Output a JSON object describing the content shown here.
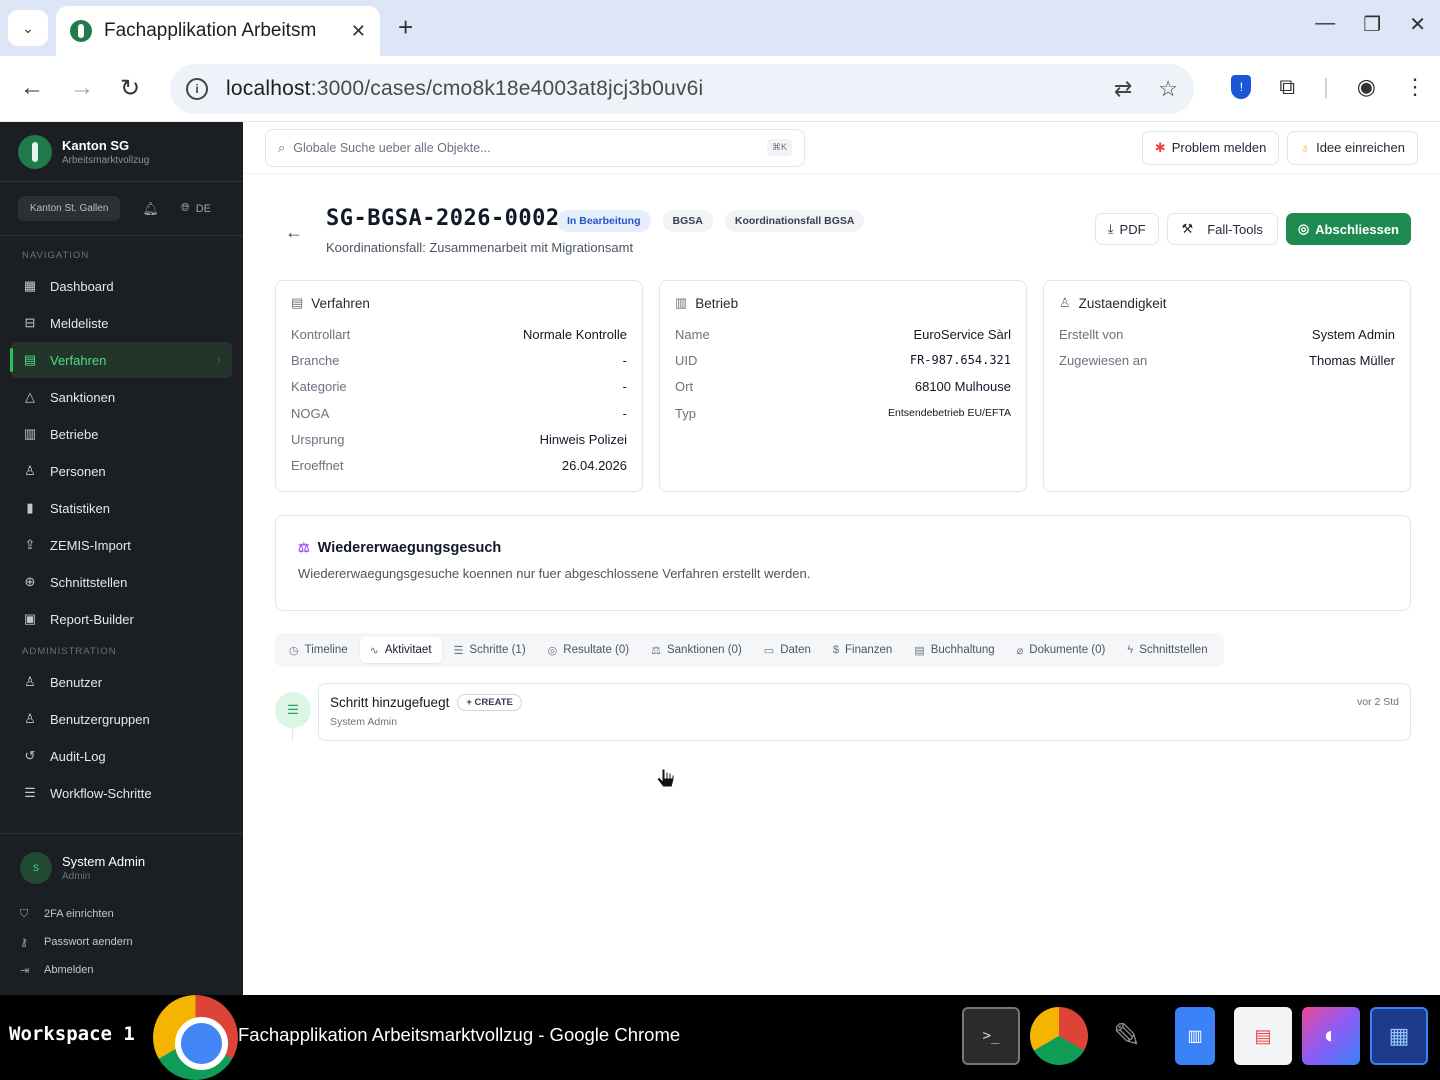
{
  "browser": {
    "tab_title": "Fachapplikation Arbeitsm",
    "url_host": "localhost",
    "url_path": ":3000/cases/cmo8k18e4003at8jcj3b0uv6i"
  },
  "sidebar": {
    "brand_title": "Kanton SG",
    "brand_subtitle": "Arbeitsmarktvollzug",
    "canton": "Kanton St. Gallen",
    "lang": "DE",
    "nav_label": "NAVIGATION",
    "nav_items": [
      {
        "label": "Dashboard",
        "icon": "grid"
      },
      {
        "label": "Meldeliste",
        "icon": "inbox"
      },
      {
        "label": "Verfahren",
        "icon": "file"
      },
      {
        "label": "Sanktionen",
        "icon": "warning"
      },
      {
        "label": "Betriebe",
        "icon": "building"
      },
      {
        "label": "Personen",
        "icon": "user"
      },
      {
        "label": "Statistiken",
        "icon": "chart"
      },
      {
        "label": "ZEMIS-Import",
        "icon": "upload"
      },
      {
        "label": "Schnittstellen",
        "icon": "globe"
      },
      {
        "label": "Report-Builder",
        "icon": "report"
      }
    ],
    "admin_label": "ADMINISTRATION",
    "admin_items": [
      {
        "label": "Benutzer",
        "icon": "users"
      },
      {
        "label": "Benutzergruppen",
        "icon": "users"
      },
      {
        "label": "Audit-Log",
        "icon": "history"
      },
      {
        "label": "Workflow-Schritte",
        "icon": "list"
      }
    ],
    "user_initial": "S",
    "user_name": "System Admin",
    "user_role": "Admin",
    "footer_links": [
      "2FA einrichten",
      "Passwort aendern",
      "Abmelden"
    ]
  },
  "topbar": {
    "search_placeholder": "Globale Suche ueber alle Objekte...",
    "shortcut": "⌘K",
    "report_problem": "Problem melden",
    "submit_idea": "Idee einreichen"
  },
  "case": {
    "id": "SG-BGSA-2026-0002",
    "status": "In Bearbeitung",
    "tag1": "BGSA",
    "tag2": "Koordinationsfall BGSA",
    "subtitle": "Koordinationsfall: Zusammenarbeit mit Migrationsamt",
    "btn_pdf": "PDF",
    "btn_tools": "Fall-Tools",
    "btn_close": "Abschliessen"
  },
  "cards": {
    "verfahren": {
      "title": "Verfahren",
      "rows": [
        {
          "k": "Kontrollart",
          "v": "Normale Kontrolle"
        },
        {
          "k": "Branche",
          "v": "-"
        },
        {
          "k": "Kategorie",
          "v": "-"
        },
        {
          "k": "NOGA",
          "v": "-"
        },
        {
          "k": "Ursprung",
          "v": "Hinweis Polizei"
        },
        {
          "k": "Eroeffnet",
          "v": "26.04.2026"
        }
      ]
    },
    "betrieb": {
      "title": "Betrieb",
      "rows": [
        {
          "k": "Name",
          "v": "EuroService Sàrl"
        },
        {
          "k": "UID",
          "v": "FR-987.654.321"
        },
        {
          "k": "Ort",
          "v": "68100 Mulhouse"
        },
        {
          "k": "Typ",
          "v": "Entsendebetrieb EU/EFTA"
        }
      ]
    },
    "zustaendigkeit": {
      "title": "Zustaendigkeit",
      "rows": [
        {
          "k": "Erstellt von",
          "v": "System Admin"
        },
        {
          "k": "Zugewiesen an",
          "v": "Thomas Müller"
        }
      ]
    }
  },
  "reconsideration": {
    "title": "Wiedererwaegungsgesuch",
    "text": "Wiedererwaegungsgesuche koennen nur fuer abgeschlossene Verfahren erstellt werden."
  },
  "tabs": [
    {
      "label": "Timeline",
      "icon": "clock"
    },
    {
      "label": "Aktivitaet",
      "icon": "activity"
    },
    {
      "label": "Schritte (1)",
      "icon": "list"
    },
    {
      "label": "Resultate (0)",
      "icon": "check"
    },
    {
      "label": "Sanktionen (0)",
      "icon": "scale"
    },
    {
      "label": "Daten",
      "icon": "calendar"
    },
    {
      "label": "Finanzen",
      "icon": "dollar"
    },
    {
      "label": "Buchhaltung",
      "icon": "ledger"
    },
    {
      "label": "Dokumente (0)",
      "icon": "clip"
    },
    {
      "label": "Schnittstellen",
      "icon": "plug"
    }
  ],
  "activity": {
    "title": "Schritt hinzugefuegt",
    "tag": "CREATE",
    "user": "System Admin",
    "time": "vor 2 Std"
  },
  "taskbar": {
    "workspace": "Workspace 1",
    "window_title": "Fachapplikation Arbeitsmarktvollzug - Google Chrome"
  }
}
